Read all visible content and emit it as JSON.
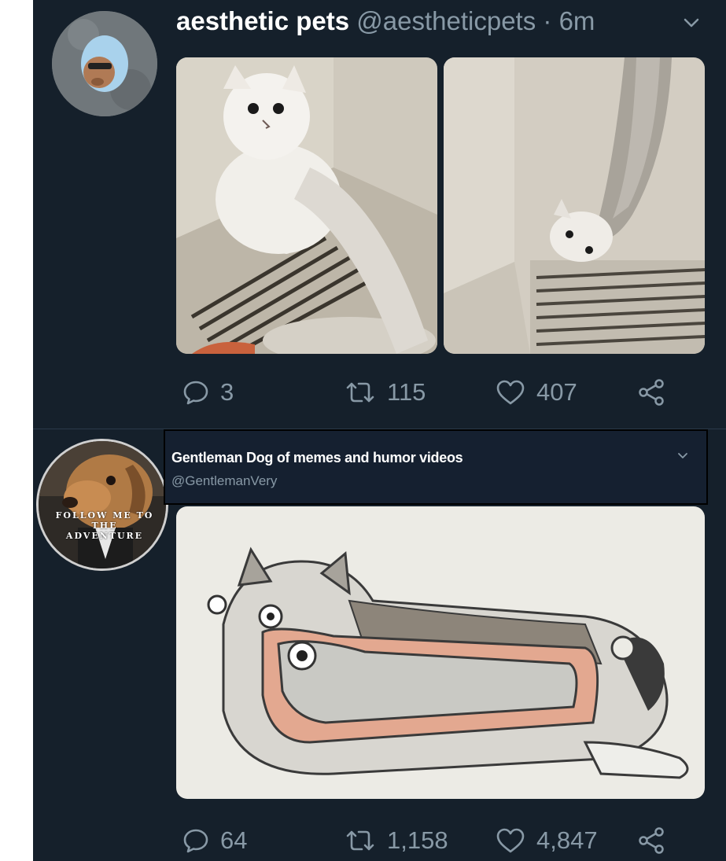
{
  "tweets": [
    {
      "display_name": "aesthetic pets",
      "handle": "@aestheticpets",
      "separator": "·",
      "time": "6m",
      "reply_count": "3",
      "retweet_count": "115",
      "like_count": "407",
      "icons": [
        "reply-icon",
        "retweet-icon",
        "like-icon",
        "share-icon",
        "chevron-down-icon"
      ]
    },
    {
      "display_name": "Gentleman Dog of memes and humor videos",
      "handle": "@GentlemanVery",
      "avatar_banner": [
        "FOLLOW ME TO",
        "THE",
        "ADVENTURE"
      ],
      "reply_count": "64",
      "retweet_count": "1,158",
      "like_count": "4,847",
      "icons": [
        "reply-icon",
        "retweet-icon",
        "like-icon",
        "share-icon",
        "chevron-down-icon"
      ]
    }
  ],
  "colors": {
    "background": "#15202b",
    "text_primary": "#ffffff",
    "text_secondary": "#8899a6"
  }
}
